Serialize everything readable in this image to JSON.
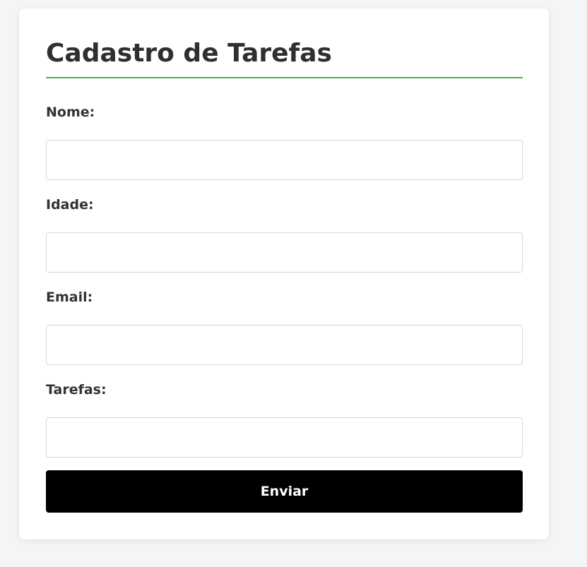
{
  "form": {
    "title": "Cadastro de Tarefas",
    "fields": [
      {
        "label": "Nome:",
        "value": "",
        "placeholder": ""
      },
      {
        "label": "Idade:",
        "value": "",
        "placeholder": ""
      },
      {
        "label": "Email:",
        "value": "",
        "placeholder": ""
      },
      {
        "label": "Tarefas:",
        "value": "",
        "placeholder": ""
      }
    ],
    "submit_label": "Enviar"
  },
  "colors": {
    "accent_rule": "#4caf50",
    "button_bg": "#000000",
    "button_text": "#ffffff",
    "page_bg": "#f4f5f7"
  }
}
